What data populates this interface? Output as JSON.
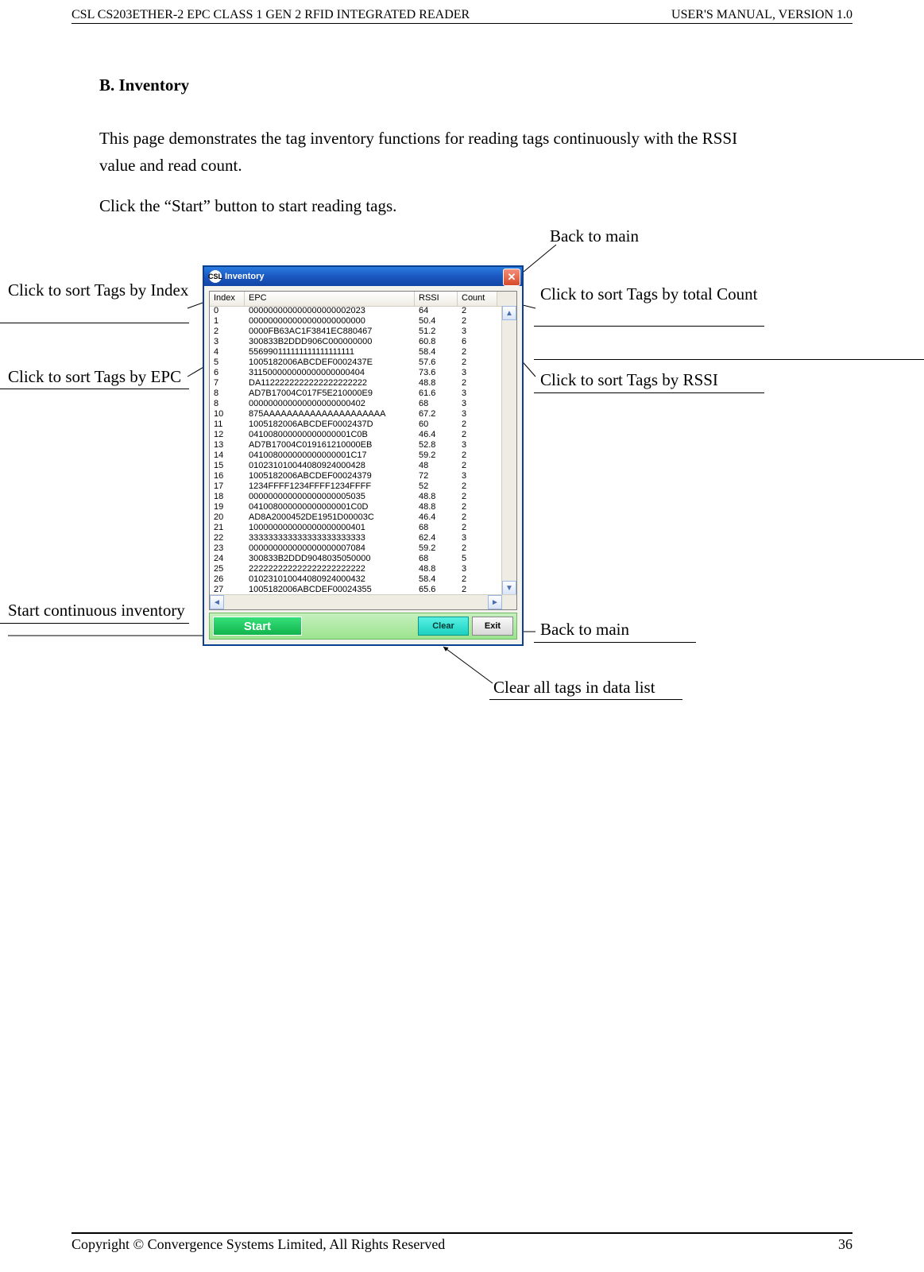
{
  "header": {
    "left": "CSL CS203ETHER-2 EPC CLASS 1 GEN 2 RFID INTEGRATED READER",
    "right": "USER'S  MANUAL,  VERSION  1.0"
  },
  "heading": "B.  Inventory",
  "para1": "This page demonstrates the tag inventory functions for reading tags continuously with the RSSI value and read count.",
  "para2": "Click the “Start” button to start reading tags.",
  "ann": {
    "back_top": "Back   to   main",
    "sort_index": "Click  to  sort  Tags  by Index",
    "sort_count": "Click  to  sort  Tags  by  total Count",
    "sort_epc": "Click to sort Tags by EPC",
    "sort_rssi": "Click to sort Tags by RSSI",
    "start_inv": "Start continuous inventory",
    "back_bot": "Back   to   main",
    "clear_tags": "Clear all tags in data list"
  },
  "window": {
    "title": "Inventory",
    "icon_text": "CSL",
    "headers": {
      "index": "Index",
      "epc": "EPC",
      "rssi": "RSSI",
      "count": "Count"
    },
    "buttons": {
      "start": "Start",
      "clear": "Clear",
      "exit": "Exit"
    },
    "rows": [
      {
        "i": "0",
        "epc": "000000000000000000002023",
        "r": "64",
        "c": "2"
      },
      {
        "i": "1",
        "epc": "000000000000000000000000",
        "r": "50.4",
        "c": "2"
      },
      {
        "i": "2",
        "epc": "0000FB63AC1F3841EC880467",
        "r": "51.2",
        "c": "3"
      },
      {
        "i": "3",
        "epc": "300833B2DDD906C000000000",
        "r": "60.8",
        "c": "6"
      },
      {
        "i": "4",
        "epc": "556990111111111111111111",
        "r": "58.4",
        "c": "2"
      },
      {
        "i": "5",
        "epc": "1005182006ABCDEF0002437E",
        "r": "57.6",
        "c": "2"
      },
      {
        "i": "6",
        "epc": "311500000000000000000404",
        "r": "73.6",
        "c": "3"
      },
      {
        "i": "7",
        "epc": "DA1122222222222222222222",
        "r": "48.8",
        "c": "2"
      },
      {
        "i": "8",
        "epc": "AD7B17004C017F5E210000E9",
        "r": "61.6",
        "c": "3"
      },
      {
        "i": "8",
        "epc": "000000000000000000000402",
        "r": "68",
        "c": "3"
      },
      {
        "i": "10",
        "epc": "875AAAAAAAAAAAAAAAAAAAAA",
        "r": "67.2",
        "c": "3"
      },
      {
        "i": "11",
        "epc": "1005182006ABCDEF0002437D",
        "r": "60",
        "c": "2"
      },
      {
        "i": "12",
        "epc": "041008000000000000001C0B",
        "r": "46.4",
        "c": "2"
      },
      {
        "i": "13",
        "epc": "AD7B17004C019161210000EB",
        "r": "52.8",
        "c": "3"
      },
      {
        "i": "14",
        "epc": "041008000000000000001C17",
        "r": "59.2",
        "c": "2"
      },
      {
        "i": "15",
        "epc": "010231010044080924000428",
        "r": "48",
        "c": "2"
      },
      {
        "i": "16",
        "epc": "1005182006ABCDEF00024379",
        "r": "72",
        "c": "3"
      },
      {
        "i": "17",
        "epc": "1234FFFF1234FFFF1234FFFF",
        "r": "52",
        "c": "2"
      },
      {
        "i": "18",
        "epc": "000000000000000000005035",
        "r": "48.8",
        "c": "2"
      },
      {
        "i": "19",
        "epc": "041008000000000000001C0D",
        "r": "48.8",
        "c": "2"
      },
      {
        "i": "20",
        "epc": "AD8A2000452DE1951D00003C",
        "r": "46.4",
        "c": "2"
      },
      {
        "i": "21",
        "epc": "100000000000000000000401",
        "r": "68",
        "c": "2"
      },
      {
        "i": "22",
        "epc": "333333333333333333333333",
        "r": "62.4",
        "c": "3"
      },
      {
        "i": "23",
        "epc": "000000000000000000007084",
        "r": "59.2",
        "c": "2"
      },
      {
        "i": "24",
        "epc": "300833B2DDD9048035050000",
        "r": "68",
        "c": "5"
      },
      {
        "i": "25",
        "epc": "222222222222222222222222",
        "r": "48.8",
        "c": "3"
      },
      {
        "i": "26",
        "epc": "010231010044080924000432",
        "r": "58.4",
        "c": "2"
      },
      {
        "i": "27",
        "epc": "1005182006ABCDEF00024355",
        "r": "65.6",
        "c": "2"
      }
    ]
  },
  "footer": {
    "left": "Copyright © Convergence Systems Limited, All Rights Reserved",
    "right": "36"
  }
}
